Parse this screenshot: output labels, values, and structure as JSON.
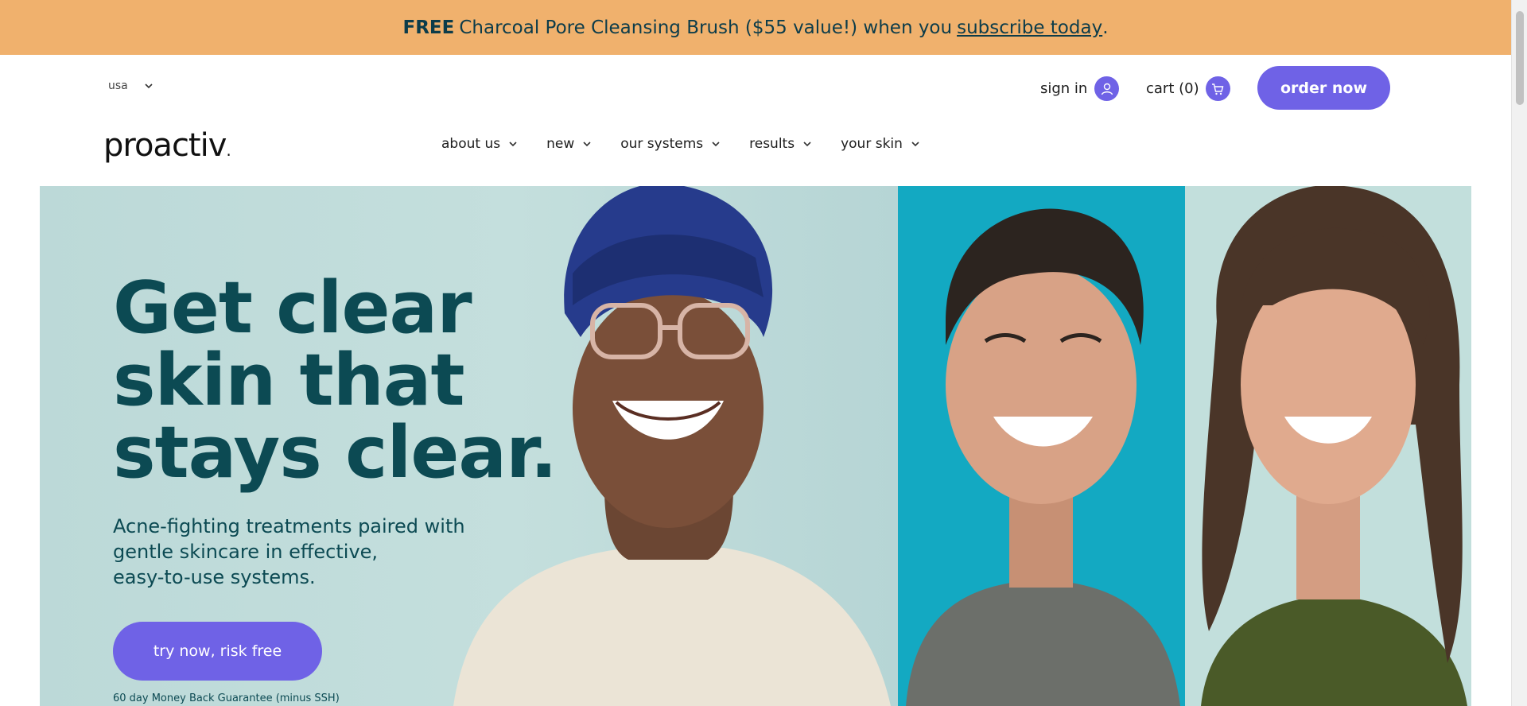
{
  "promo": {
    "free": "FREE",
    "text": "Charcoal Pore Cleansing Brush ($55 value!) when you",
    "link": "subscribe today",
    "end": "."
  },
  "header": {
    "region": "usa",
    "signin": "sign in",
    "cart": "cart (0)",
    "order": "order now",
    "logo": "proactiv",
    "logo_mark": "."
  },
  "nav": {
    "items": [
      {
        "label": "about us"
      },
      {
        "label": "new"
      },
      {
        "label": "our systems"
      },
      {
        "label": "results"
      },
      {
        "label": "your skin"
      }
    ]
  },
  "hero": {
    "headline_1": "Get clear",
    "headline_2": "skin that",
    "headline_3": "stays clear.",
    "sub_1": "Acne-fighting treatments paired with",
    "sub_2": "gentle skincare in effective,",
    "sub_3": "easy-to-use systems.",
    "cta": "try now, risk free",
    "guarantee": "60 day Money Back Guarantee (minus SSH)"
  },
  "colors": {
    "brand": "#6f62e6",
    "banner": "#f0b16d",
    "heading": "#0c4a53"
  }
}
